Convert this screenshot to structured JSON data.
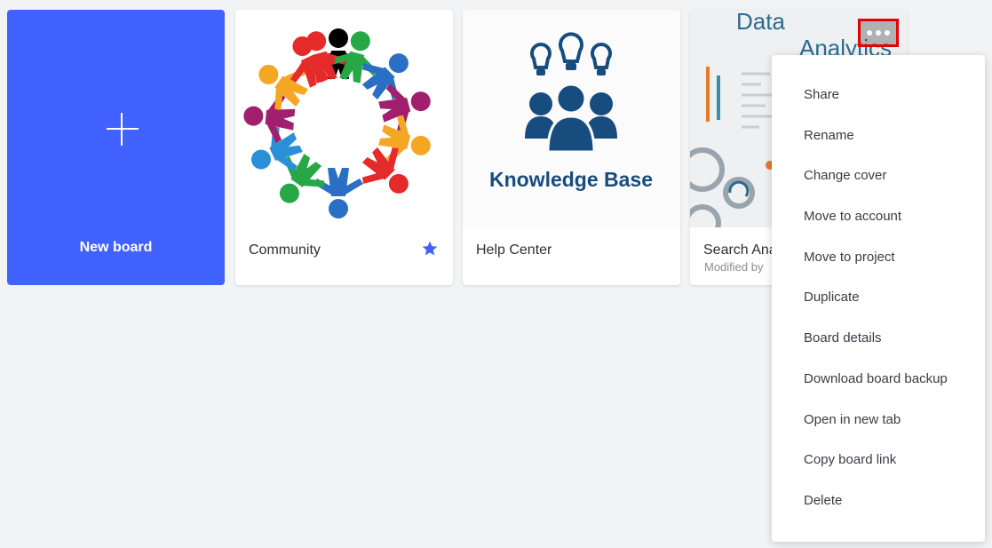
{
  "boards": [
    {
      "title": "New board"
    },
    {
      "title": "Community",
      "starred": true
    },
    {
      "title": "Help Center",
      "thumbnail_text": "Knowledge Base"
    },
    {
      "title": "Search Ana",
      "meta": "Modified by",
      "thumbnail_text": [
        "Data",
        "Analytics"
      ]
    }
  ],
  "context_menu": {
    "items": [
      "Share",
      "Rename",
      "Change cover",
      "Move to account",
      "Move to project",
      "Duplicate",
      "Board details",
      "Download board backup",
      "Open in new tab",
      "Copy board link",
      "Delete"
    ]
  },
  "colors": {
    "accent": "#4262ff",
    "background": "#f2f3f5",
    "highlight": "#e60000"
  }
}
